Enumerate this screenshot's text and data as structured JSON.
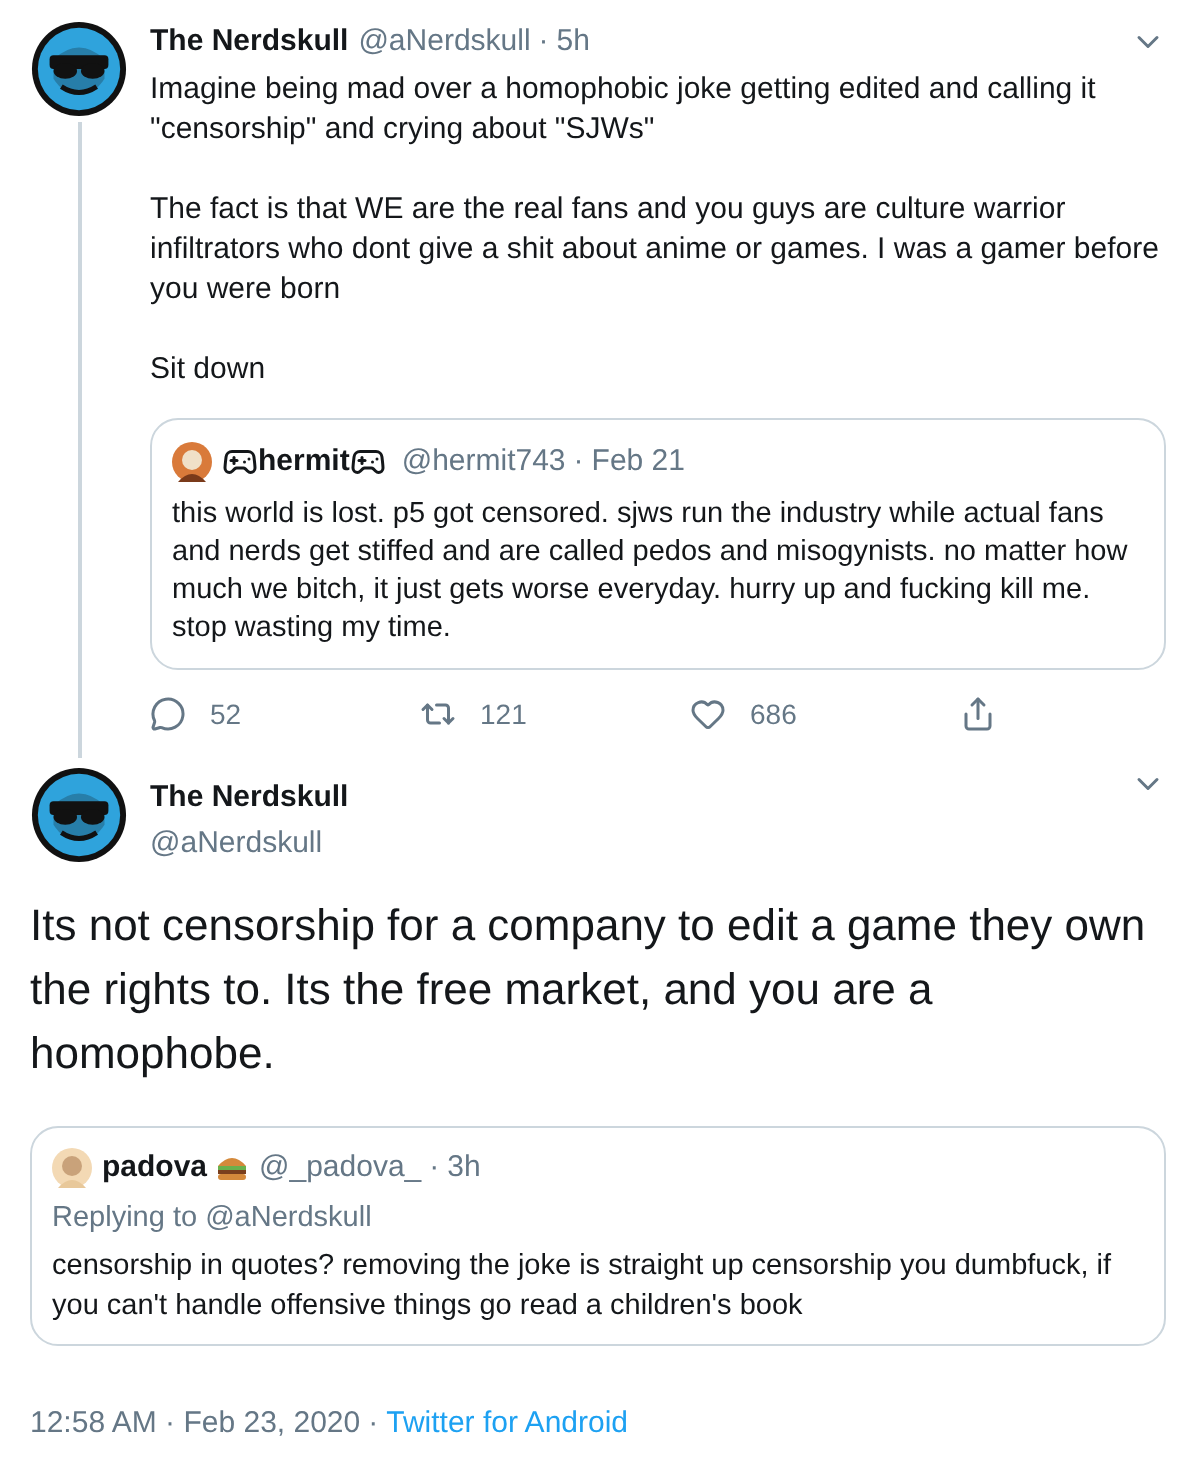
{
  "tweet": {
    "name": "The Nerdskull",
    "handle": "@aNerdskull",
    "separator": "·",
    "time": "5h",
    "paragraphs": [
      "Imagine being mad over a homophobic joke getting edited and calling it \"censorship\" and crying about \"SJWs\"",
      "The fact is that WE are the real fans and you guys are culture warrior infiltrators who dont give a shit about anime or games. I was a gamer before you were born",
      "Sit down"
    ],
    "quote": {
      "name": "hermit",
      "handle": "@hermit743",
      "separator": "·",
      "time": "Feb 21",
      "text": "this world is lost. p5 got censored. sjws run the industry while actual fans and nerds get stiffed and are called pedos and misogynists. no matter how much we bitch, it just gets worse everyday. hurry up and fucking kill me. stop wasting my time."
    },
    "actions": [
      {
        "kind": "reply",
        "count": "52"
      },
      {
        "kind": "retweet",
        "count": "121"
      },
      {
        "kind": "like",
        "count": "686"
      },
      {
        "kind": "share"
      }
    ]
  },
  "main_tweet": {
    "name": "The Nerdskull",
    "handle": "@aNerdskull",
    "text": "Its not censorship for a company to edit a game they own the rights to. Its the free market, and you are a homophobe.",
    "quote": {
      "name": "padova",
      "handle": "@_padova_",
      "separator": "·",
      "time": "3h",
      "replying_to": "Replying to @aNerdskull",
      "text": "censorship in quotes? removing the joke is straight up censorship you dumbfuck, if you can't handle offensive things go read a children's book"
    },
    "footer": {
      "timestamp": "12:58 AM · Feb 23, 2020",
      "separator": "·",
      "source": "Twitter for Android"
    }
  }
}
